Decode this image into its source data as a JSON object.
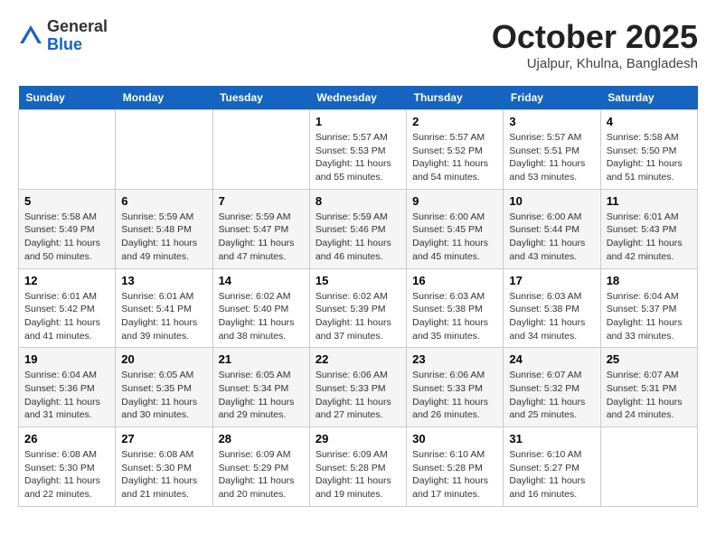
{
  "header": {
    "logo_line1": "General",
    "logo_line2": "Blue",
    "month": "October 2025",
    "location": "Ujalpur, Khulna, Bangladesh"
  },
  "weekdays": [
    "Sunday",
    "Monday",
    "Tuesday",
    "Wednesday",
    "Thursday",
    "Friday",
    "Saturday"
  ],
  "weeks": [
    [
      {
        "day": "",
        "info": ""
      },
      {
        "day": "",
        "info": ""
      },
      {
        "day": "",
        "info": ""
      },
      {
        "day": "1",
        "info": "Sunrise: 5:57 AM\nSunset: 5:53 PM\nDaylight: 11 hours\nand 55 minutes."
      },
      {
        "day": "2",
        "info": "Sunrise: 5:57 AM\nSunset: 5:52 PM\nDaylight: 11 hours\nand 54 minutes."
      },
      {
        "day": "3",
        "info": "Sunrise: 5:57 AM\nSunset: 5:51 PM\nDaylight: 11 hours\nand 53 minutes."
      },
      {
        "day": "4",
        "info": "Sunrise: 5:58 AM\nSunset: 5:50 PM\nDaylight: 11 hours\nand 51 minutes."
      }
    ],
    [
      {
        "day": "5",
        "info": "Sunrise: 5:58 AM\nSunset: 5:49 PM\nDaylight: 11 hours\nand 50 minutes."
      },
      {
        "day": "6",
        "info": "Sunrise: 5:59 AM\nSunset: 5:48 PM\nDaylight: 11 hours\nand 49 minutes."
      },
      {
        "day": "7",
        "info": "Sunrise: 5:59 AM\nSunset: 5:47 PM\nDaylight: 11 hours\nand 47 minutes."
      },
      {
        "day": "8",
        "info": "Sunrise: 5:59 AM\nSunset: 5:46 PM\nDaylight: 11 hours\nand 46 minutes."
      },
      {
        "day": "9",
        "info": "Sunrise: 6:00 AM\nSunset: 5:45 PM\nDaylight: 11 hours\nand 45 minutes."
      },
      {
        "day": "10",
        "info": "Sunrise: 6:00 AM\nSunset: 5:44 PM\nDaylight: 11 hours\nand 43 minutes."
      },
      {
        "day": "11",
        "info": "Sunrise: 6:01 AM\nSunset: 5:43 PM\nDaylight: 11 hours\nand 42 minutes."
      }
    ],
    [
      {
        "day": "12",
        "info": "Sunrise: 6:01 AM\nSunset: 5:42 PM\nDaylight: 11 hours\nand 41 minutes."
      },
      {
        "day": "13",
        "info": "Sunrise: 6:01 AM\nSunset: 5:41 PM\nDaylight: 11 hours\nand 39 minutes."
      },
      {
        "day": "14",
        "info": "Sunrise: 6:02 AM\nSunset: 5:40 PM\nDaylight: 11 hours\nand 38 minutes."
      },
      {
        "day": "15",
        "info": "Sunrise: 6:02 AM\nSunset: 5:39 PM\nDaylight: 11 hours\nand 37 minutes."
      },
      {
        "day": "16",
        "info": "Sunrise: 6:03 AM\nSunset: 5:38 PM\nDaylight: 11 hours\nand 35 minutes."
      },
      {
        "day": "17",
        "info": "Sunrise: 6:03 AM\nSunset: 5:38 PM\nDaylight: 11 hours\nand 34 minutes."
      },
      {
        "day": "18",
        "info": "Sunrise: 6:04 AM\nSunset: 5:37 PM\nDaylight: 11 hours\nand 33 minutes."
      }
    ],
    [
      {
        "day": "19",
        "info": "Sunrise: 6:04 AM\nSunset: 5:36 PM\nDaylight: 11 hours\nand 31 minutes."
      },
      {
        "day": "20",
        "info": "Sunrise: 6:05 AM\nSunset: 5:35 PM\nDaylight: 11 hours\nand 30 minutes."
      },
      {
        "day": "21",
        "info": "Sunrise: 6:05 AM\nSunset: 5:34 PM\nDaylight: 11 hours\nand 29 minutes."
      },
      {
        "day": "22",
        "info": "Sunrise: 6:06 AM\nSunset: 5:33 PM\nDaylight: 11 hours\nand 27 minutes."
      },
      {
        "day": "23",
        "info": "Sunrise: 6:06 AM\nSunset: 5:33 PM\nDaylight: 11 hours\nand 26 minutes."
      },
      {
        "day": "24",
        "info": "Sunrise: 6:07 AM\nSunset: 5:32 PM\nDaylight: 11 hours\nand 25 minutes."
      },
      {
        "day": "25",
        "info": "Sunrise: 6:07 AM\nSunset: 5:31 PM\nDaylight: 11 hours\nand 24 minutes."
      }
    ],
    [
      {
        "day": "26",
        "info": "Sunrise: 6:08 AM\nSunset: 5:30 PM\nDaylight: 11 hours\nand 22 minutes."
      },
      {
        "day": "27",
        "info": "Sunrise: 6:08 AM\nSunset: 5:30 PM\nDaylight: 11 hours\nand 21 minutes."
      },
      {
        "day": "28",
        "info": "Sunrise: 6:09 AM\nSunset: 5:29 PM\nDaylight: 11 hours\nand 20 minutes."
      },
      {
        "day": "29",
        "info": "Sunrise: 6:09 AM\nSunset: 5:28 PM\nDaylight: 11 hours\nand 19 minutes."
      },
      {
        "day": "30",
        "info": "Sunrise: 6:10 AM\nSunset: 5:28 PM\nDaylight: 11 hours\nand 17 minutes."
      },
      {
        "day": "31",
        "info": "Sunrise: 6:10 AM\nSunset: 5:27 PM\nDaylight: 11 hours\nand 16 minutes."
      },
      {
        "day": "",
        "info": ""
      }
    ]
  ]
}
